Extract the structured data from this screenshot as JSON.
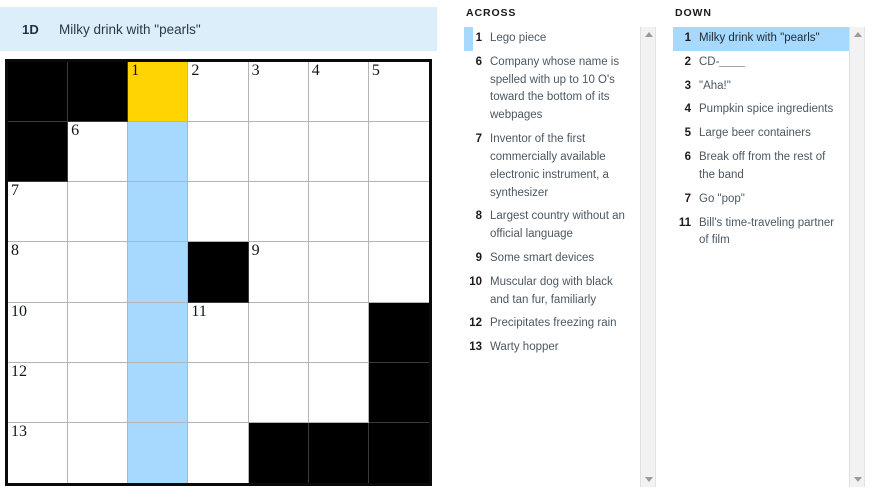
{
  "clue_bar": {
    "number": "1D",
    "text": "Milky drink with \"pearls\""
  },
  "colors": {
    "active_cell": "#ffd400",
    "highlight_cell": "#a7d8fd",
    "clue_bar_bg": "#dceef9",
    "black_cell": "#000000",
    "selected_clue_bg": "#a7d8fd"
  },
  "grid": {
    "rows": 7,
    "cols": 7,
    "cells": [
      [
        {
          "state": "black"
        },
        {
          "state": "black"
        },
        {
          "state": "active",
          "number": "1",
          "letter": ""
        },
        {
          "state": "empty",
          "number": "2",
          "letter": ""
        },
        {
          "state": "empty",
          "number": "3",
          "letter": ""
        },
        {
          "state": "empty",
          "number": "4",
          "letter": ""
        },
        {
          "state": "empty",
          "number": "5",
          "letter": ""
        }
      ],
      [
        {
          "state": "black"
        },
        {
          "state": "empty",
          "number": "6",
          "letter": ""
        },
        {
          "state": "highlight",
          "letter": ""
        },
        {
          "state": "empty",
          "letter": ""
        },
        {
          "state": "empty",
          "letter": ""
        },
        {
          "state": "empty",
          "letter": ""
        },
        {
          "state": "empty",
          "letter": ""
        }
      ],
      [
        {
          "state": "empty",
          "number": "7",
          "letter": ""
        },
        {
          "state": "empty",
          "letter": ""
        },
        {
          "state": "highlight",
          "letter": ""
        },
        {
          "state": "empty",
          "letter": ""
        },
        {
          "state": "empty",
          "letter": ""
        },
        {
          "state": "empty",
          "letter": ""
        },
        {
          "state": "empty",
          "letter": ""
        }
      ],
      [
        {
          "state": "empty",
          "number": "8",
          "letter": ""
        },
        {
          "state": "empty",
          "letter": ""
        },
        {
          "state": "highlight",
          "letter": ""
        },
        {
          "state": "black"
        },
        {
          "state": "empty",
          "number": "9",
          "letter": ""
        },
        {
          "state": "empty",
          "letter": ""
        },
        {
          "state": "empty",
          "letter": ""
        }
      ],
      [
        {
          "state": "empty",
          "number": "10",
          "letter": ""
        },
        {
          "state": "empty",
          "letter": ""
        },
        {
          "state": "highlight",
          "letter": ""
        },
        {
          "state": "empty",
          "number": "11",
          "letter": ""
        },
        {
          "state": "empty",
          "letter": ""
        },
        {
          "state": "empty",
          "letter": ""
        },
        {
          "state": "black"
        }
      ],
      [
        {
          "state": "empty",
          "number": "12",
          "letter": ""
        },
        {
          "state": "empty",
          "letter": ""
        },
        {
          "state": "highlight",
          "letter": ""
        },
        {
          "state": "empty",
          "letter": ""
        },
        {
          "state": "empty",
          "letter": ""
        },
        {
          "state": "empty",
          "letter": ""
        },
        {
          "state": "black"
        }
      ],
      [
        {
          "state": "empty",
          "number": "13",
          "letter": ""
        },
        {
          "state": "empty",
          "letter": ""
        },
        {
          "state": "highlight",
          "letter": ""
        },
        {
          "state": "empty",
          "letter": ""
        },
        {
          "state": "black"
        },
        {
          "state": "black"
        },
        {
          "state": "black"
        }
      ]
    ]
  },
  "across": {
    "title": "ACROSS",
    "clues": [
      {
        "number": "1",
        "text": "Lego piece",
        "state": "marked"
      },
      {
        "number": "6",
        "text": "Company whose name is spelled with up to 10 O's toward the bottom of its webpages",
        "state": "normal"
      },
      {
        "number": "7",
        "text": "Inventor of the first commercially available electronic instrument, a synthesizer",
        "state": "normal"
      },
      {
        "number": "8",
        "text": "Largest country without an official language",
        "state": "normal"
      },
      {
        "number": "9",
        "text": "Some smart devices",
        "state": "normal"
      },
      {
        "number": "10",
        "text": "Muscular dog with black and tan fur, familiarly",
        "state": "normal"
      },
      {
        "number": "12",
        "text": "Precipitates freezing rain",
        "state": "normal"
      },
      {
        "number": "13",
        "text": "Warty hopper",
        "state": "normal"
      }
    ]
  },
  "down": {
    "title": "DOWN",
    "clues": [
      {
        "number": "1",
        "text": "Milky drink with \"pearls\"",
        "state": "selected"
      },
      {
        "number": "2",
        "text": "CD-",
        "blank": true,
        "state": "normal"
      },
      {
        "number": "3",
        "text": "\"Aha!\"",
        "state": "normal"
      },
      {
        "number": "4",
        "text": "Pumpkin spice ingredients",
        "state": "normal"
      },
      {
        "number": "5",
        "text": "Large beer containers",
        "state": "normal"
      },
      {
        "number": "6",
        "text": "Break off from the rest of the band",
        "state": "normal"
      },
      {
        "number": "7",
        "text": "Go \"pop\"",
        "state": "normal"
      },
      {
        "number": "11",
        "text": "Bill's time-traveling partner of film",
        "state": "normal"
      }
    ]
  },
  "scrollbars": {
    "across": {
      "up_arrow": "scroll-up",
      "down_arrow": "scroll-down"
    },
    "down": {
      "up_arrow": "scroll-up",
      "down_arrow": "scroll-down"
    }
  }
}
